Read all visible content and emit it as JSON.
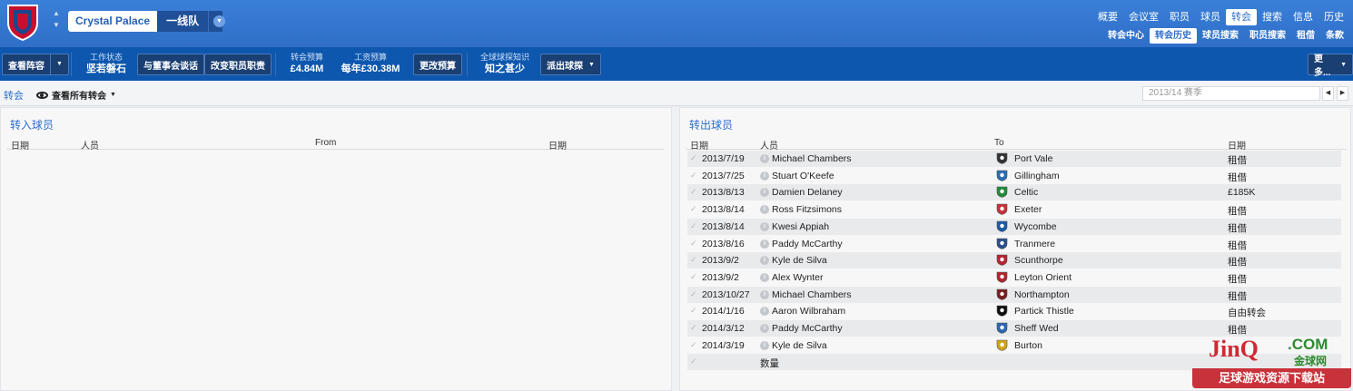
{
  "header": {
    "team_name": "Crystal Palace",
    "squad": "一线队",
    "nav_main": [
      "概要",
      "会议室",
      "职员",
      "球员",
      "转会",
      "搜索",
      "信息",
      "历史"
    ],
    "nav_main_active": 4,
    "nav_sub": [
      "转会中心",
      "转会历史",
      "球员搜索",
      "职员搜索",
      "租借",
      "条款"
    ],
    "nav_sub_active": 1
  },
  "toolbar": {
    "view_squad": "查看阵容",
    "work_status_label": "工作状态",
    "work_status_value": "坚若磐石",
    "talk_board": "与董事会谈话",
    "change_staff": "改变职员职责",
    "transfer_budget_label": "转会预算",
    "transfer_budget_value": "£4.84M",
    "wage_budget_label": "工资预算",
    "wage_budget_value": "每年£30.38M",
    "change_budget": "更改预算",
    "scout_knowledge_label": "全球球探知识",
    "scout_knowledge_value": "知之甚少",
    "send_scout": "派出球探",
    "more": "更多..."
  },
  "subheader": {
    "crumb": "转会",
    "view_filter": "查看所有转会",
    "season": "2013/14 赛季"
  },
  "transfers_in": {
    "title": "转入球员",
    "columns": [
      "日期",
      "人员",
      "From",
      "日期"
    ]
  },
  "transfers_out": {
    "title": "转出球员",
    "columns": [
      "日期",
      "人员",
      "To",
      "日期"
    ],
    "rows": [
      {
        "date": "2013/7/19",
        "person": "Michael Chambers",
        "club": "Port Vale",
        "fee": "租借"
      },
      {
        "date": "2013/7/25",
        "person": "Stuart O'Keefe",
        "club": "Gillingham",
        "fee": "租借"
      },
      {
        "date": "2013/8/13",
        "person": "Damien Delaney",
        "club": "Celtic",
        "fee": "£185K"
      },
      {
        "date": "2013/8/14",
        "person": "Ross Fitzsimons",
        "club": "Exeter",
        "fee": "租借"
      },
      {
        "date": "2013/8/14",
        "person": "Kwesi Appiah",
        "club": "Wycombe",
        "fee": "租借"
      },
      {
        "date": "2013/8/16",
        "person": "Paddy McCarthy",
        "club": "Tranmere",
        "fee": "租借"
      },
      {
        "date": "2013/9/2",
        "person": "Kyle de Silva",
        "club": "Scunthorpe",
        "fee": "租借"
      },
      {
        "date": "2013/9/2",
        "person": "Alex Wynter",
        "club": "Leyton Orient",
        "fee": "租借"
      },
      {
        "date": "2013/10/27",
        "person": "Michael Chambers",
        "club": "Northampton",
        "fee": "租借"
      },
      {
        "date": "2014/1/16",
        "person": "Aaron Wilbraham",
        "club": "Partick Thistle",
        "fee": "自由转会"
      },
      {
        "date": "2014/3/12",
        "person": "Paddy McCarthy",
        "club": "Sheff Wed",
        "fee": "租借"
      },
      {
        "date": "2014/3/19",
        "person": "Kyle de Silva",
        "club": "Burton",
        "fee": ""
      }
    ],
    "footer_label": "数量"
  },
  "watermark": {
    "brand": "JinQ",
    "domain": ".COM",
    "cn_name": "金球网",
    "slogan": "足球游戏资源下载站"
  },
  "colors": {
    "header_blue": "#2f6fc8",
    "toolbar_blue": "#0e57ae",
    "accent_red": "#d02a33"
  }
}
